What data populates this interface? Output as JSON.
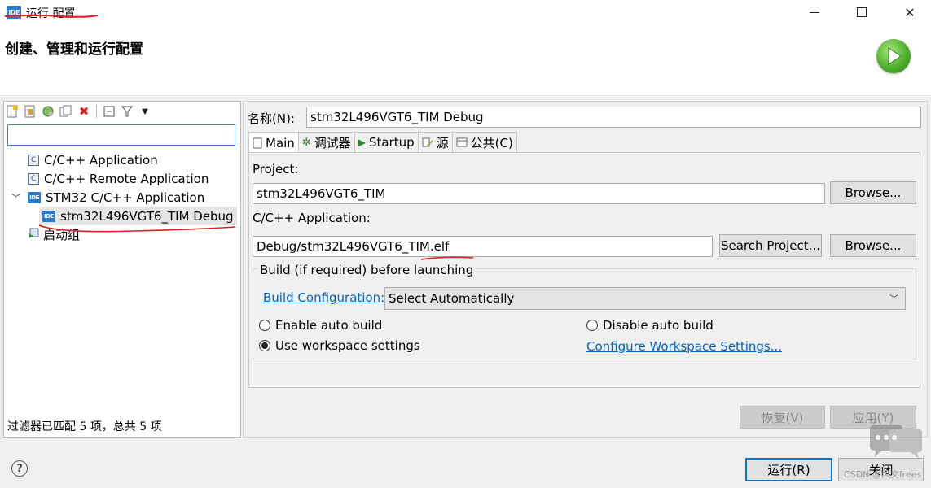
{
  "window": {
    "title": "运行 配置",
    "app_icon": "IDE"
  },
  "header": {
    "title": "创建、管理和运行配置"
  },
  "left": {
    "filter_value": "",
    "tree": [
      {
        "label": "C/C++ Application",
        "icon": "c-app-icon"
      },
      {
        "label": "C/C++ Remote Application",
        "icon": "c-app-icon"
      },
      {
        "label": "STM32 C/C++ Application",
        "icon": "ide-icon",
        "expanded": true
      },
      {
        "label": "stm32L496VGT6_TIM Debug",
        "icon": "ide-icon",
        "selected": true
      },
      {
        "label": "启动组",
        "icon": "launch-group-icon"
      }
    ],
    "status": "过滤器已匹配 5 项，总共 5 项"
  },
  "right": {
    "name_label": "名称(N):",
    "name_value": "stm32L496VGT6_TIM Debug",
    "tabs": [
      "Main",
      "调试器",
      "Startup",
      "源",
      "公共(C)"
    ],
    "project_label": "Project:",
    "project_value": "stm32L496VGT6_TIM",
    "browse_label": "Browse...",
    "app_label": "C/C++ Application:",
    "app_value": "Debug/stm32L496VGT6_TIM.elf",
    "search_project_label": "Search Project...",
    "build_group_title": "Build (if required) before launching",
    "build_config_label": "Build Configuration:",
    "build_config_value": "Select Automatically",
    "radios": {
      "enable_auto": "Enable auto build",
      "disable_auto": "Disable auto build",
      "use_workspace": "Use workspace settings"
    },
    "configure_workspace_link": "Configure Workspace Settings...",
    "revert_label": "恢复(V)",
    "apply_label": "应用(Y)"
  },
  "footer": {
    "run_label": "运行(R)",
    "close_label": "关闭",
    "watermark": "CSDN @风文frees"
  },
  "colors": {
    "link": "#0066cc",
    "annotation": "#e02020",
    "selection": "#e5e5e5"
  }
}
